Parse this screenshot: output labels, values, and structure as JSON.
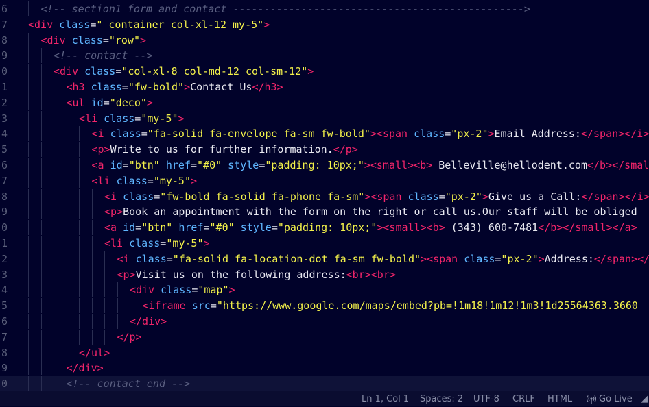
{
  "editor": {
    "lines": [
      {
        "num": "6",
        "indent": 1,
        "tokens": [
          [
            "comment",
            "<!-- section1 form and contact ----------------------------------------------->"
          ]
        ]
      },
      {
        "num": "7",
        "indent": 0,
        "tokens": [
          [
            "tag",
            "<div"
          ],
          [
            "attr",
            " class"
          ],
          [
            "punct",
            "="
          ],
          [
            "str",
            "\" container col-xl-12 my-5\""
          ],
          [
            "tag",
            ">"
          ]
        ]
      },
      {
        "num": "8",
        "indent": 1,
        "tokens": [
          [
            "tag",
            "<div"
          ],
          [
            "attr",
            " class"
          ],
          [
            "punct",
            "="
          ],
          [
            "str",
            "\"row\""
          ],
          [
            "tag",
            ">"
          ]
        ]
      },
      {
        "num": "9",
        "indent": 2,
        "tokens": [
          [
            "comment",
            "<!-- contact -->"
          ]
        ]
      },
      {
        "num": "0",
        "indent": 2,
        "tokens": [
          [
            "tag",
            "<div"
          ],
          [
            "attr",
            " class"
          ],
          [
            "punct",
            "="
          ],
          [
            "str",
            "\"col-xl-8 col-md-12 col-sm-12\""
          ],
          [
            "tag",
            ">"
          ]
        ]
      },
      {
        "num": "1",
        "indent": 3,
        "tokens": [
          [
            "tag",
            "<h3"
          ],
          [
            "attr",
            " class"
          ],
          [
            "punct",
            "="
          ],
          [
            "str",
            "\"fw-bold\""
          ],
          [
            "tag",
            ">"
          ],
          [
            "text",
            "Contact Us"
          ],
          [
            "tag",
            "</h3>"
          ]
        ]
      },
      {
        "num": "2",
        "indent": 3,
        "tokens": [
          [
            "tag",
            "<ul"
          ],
          [
            "attr",
            " id"
          ],
          [
            "punct",
            "="
          ],
          [
            "str",
            "\"deco\""
          ],
          [
            "tag",
            ">"
          ]
        ]
      },
      {
        "num": "3",
        "indent": 4,
        "tokens": [
          [
            "tag",
            "<li"
          ],
          [
            "attr",
            " class"
          ],
          [
            "punct",
            "="
          ],
          [
            "str",
            "\"my-5\""
          ],
          [
            "tag",
            ">"
          ]
        ]
      },
      {
        "num": "4",
        "indent": 5,
        "tokens": [
          [
            "tag",
            "<i"
          ],
          [
            "attr",
            " class"
          ],
          [
            "punct",
            "="
          ],
          [
            "str",
            "\"fa-solid fa-envelope fa-sm fw-bold\""
          ],
          [
            "tag",
            ">"
          ],
          [
            "tag",
            "<span"
          ],
          [
            "attr",
            " class"
          ],
          [
            "punct",
            "="
          ],
          [
            "str",
            "\"px-2\""
          ],
          [
            "tag",
            ">"
          ],
          [
            "text",
            "Email Address:"
          ],
          [
            "tag",
            "</span>"
          ],
          [
            "tag",
            "</i>"
          ]
        ]
      },
      {
        "num": "5",
        "indent": 5,
        "tokens": [
          [
            "tag",
            "<p>"
          ],
          [
            "text",
            "Write to us for further information."
          ],
          [
            "tag",
            "</p>"
          ]
        ]
      },
      {
        "num": "6",
        "indent": 5,
        "tokens": [
          [
            "tag",
            "<a"
          ],
          [
            "attr",
            " id"
          ],
          [
            "punct",
            "="
          ],
          [
            "str",
            "\"btn\""
          ],
          [
            "attr",
            " href"
          ],
          [
            "punct",
            "="
          ],
          [
            "str",
            "\"#0\""
          ],
          [
            "attr",
            " style"
          ],
          [
            "punct",
            "="
          ],
          [
            "str",
            "\"padding: 10px;\""
          ],
          [
            "tag",
            ">"
          ],
          [
            "tag",
            "<small>"
          ],
          [
            "tag",
            "<b>"
          ],
          [
            "text",
            " Belleville@hellodent.com"
          ],
          [
            "tag",
            "</b>"
          ],
          [
            "tag",
            "</small>"
          ]
        ]
      },
      {
        "num": "7",
        "indent": 5,
        "tokens": [
          [
            "tag",
            "<li"
          ],
          [
            "attr",
            " class"
          ],
          [
            "punct",
            "="
          ],
          [
            "str",
            "\"my-5\""
          ],
          [
            "tag",
            ">"
          ]
        ]
      },
      {
        "num": "8",
        "indent": 6,
        "tokens": [
          [
            "tag",
            "<i"
          ],
          [
            "attr",
            " class"
          ],
          [
            "punct",
            "="
          ],
          [
            "str",
            "\"fw-bold fa-solid fa-phone fa-sm\""
          ],
          [
            "tag",
            ">"
          ],
          [
            "tag",
            "<span"
          ],
          [
            "attr",
            " class"
          ],
          [
            "punct",
            "="
          ],
          [
            "str",
            "\"px-2\""
          ],
          [
            "tag",
            ">"
          ],
          [
            "text",
            "Give us a Call:"
          ],
          [
            "tag",
            "</span>"
          ],
          [
            "tag",
            "</i>"
          ]
        ]
      },
      {
        "num": "9",
        "indent": 6,
        "tokens": [
          [
            "tag",
            "<p>"
          ],
          [
            "text",
            "Book an appointment with the form on the right or call us.Our staff will be obliged"
          ]
        ]
      },
      {
        "num": "0",
        "indent": 6,
        "tokens": [
          [
            "tag",
            "<a"
          ],
          [
            "attr",
            " id"
          ],
          [
            "punct",
            "="
          ],
          [
            "str",
            "\"btn\""
          ],
          [
            "attr",
            " href"
          ],
          [
            "punct",
            "="
          ],
          [
            "str",
            "\"#0\""
          ],
          [
            "attr",
            " style"
          ],
          [
            "punct",
            "="
          ],
          [
            "str",
            "\"padding: 10px;\""
          ],
          [
            "tag",
            ">"
          ],
          [
            "tag",
            "<small>"
          ],
          [
            "tag",
            "<b>"
          ],
          [
            "text",
            " (343) 600-7481"
          ],
          [
            "tag",
            "</b>"
          ],
          [
            "tag",
            "</small>"
          ],
          [
            "tag",
            "</a>"
          ]
        ]
      },
      {
        "num": "1",
        "indent": 6,
        "tokens": [
          [
            "tag",
            "<li"
          ],
          [
            "attr",
            " class"
          ],
          [
            "punct",
            "="
          ],
          [
            "str",
            "\"my-5\""
          ],
          [
            "tag",
            ">"
          ]
        ]
      },
      {
        "num": "2",
        "indent": 7,
        "tokens": [
          [
            "tag",
            "<i"
          ],
          [
            "attr",
            " class"
          ],
          [
            "punct",
            "="
          ],
          [
            "str",
            "\"fa-solid fa-location-dot fa-sm fw-bold\""
          ],
          [
            "tag",
            ">"
          ],
          [
            "tag",
            "<span"
          ],
          [
            "attr",
            " class"
          ],
          [
            "punct",
            "="
          ],
          [
            "str",
            "\"px-2\""
          ],
          [
            "tag",
            ">"
          ],
          [
            "text",
            "Address:"
          ],
          [
            "tag",
            "</span>"
          ],
          [
            "tag",
            "</i>"
          ]
        ]
      },
      {
        "num": "3",
        "indent": 7,
        "tokens": [
          [
            "tag",
            "<p>"
          ],
          [
            "text",
            "Visit us on the following address:"
          ],
          [
            "tag",
            "<br>"
          ],
          [
            "tag",
            "<br>"
          ]
        ]
      },
      {
        "num": "4",
        "indent": 8,
        "tokens": [
          [
            "tag",
            "<div"
          ],
          [
            "attr",
            " class"
          ],
          [
            "punct",
            "="
          ],
          [
            "str",
            "\"map\""
          ],
          [
            "tag",
            ">"
          ]
        ]
      },
      {
        "num": "5",
        "indent": 9,
        "tokens": [
          [
            "tag",
            "<iframe"
          ],
          [
            "attr",
            " src"
          ],
          [
            "punct",
            "="
          ],
          [
            "str",
            "\""
          ],
          [
            "url",
            "https://www.google.com/maps/embed?pb=!1m18!1m12!1m3!1d25564363.3660"
          ]
        ]
      },
      {
        "num": "6",
        "indent": 8,
        "tokens": [
          [
            "tag",
            "</div>"
          ]
        ]
      },
      {
        "num": "7",
        "indent": 7,
        "tokens": [
          [
            "tag",
            "</p>"
          ]
        ]
      },
      {
        "num": "8",
        "indent": 4,
        "tokens": [
          [
            "tag",
            "</ul>"
          ]
        ]
      },
      {
        "num": "9",
        "indent": 3,
        "tokens": [
          [
            "tag",
            "</div>"
          ]
        ]
      },
      {
        "num": "0",
        "indent": 3,
        "current": true,
        "tokens": [
          [
            "comment",
            "<!-- contact end -->"
          ]
        ]
      }
    ]
  },
  "statusbar": {
    "position": "Ln 1, Col 1",
    "spaces": "Spaces: 2",
    "encoding": "UTF-8",
    "eol": "CRLF",
    "language": "HTML",
    "golive": "Go Live",
    "golive_icon": "broadcast-icon"
  },
  "colors": {
    "background": "#01022a",
    "tag": "#f2256a",
    "attribute": "#5fb6ff",
    "string": "#f2f04a",
    "comment": "#5a5f80"
  }
}
